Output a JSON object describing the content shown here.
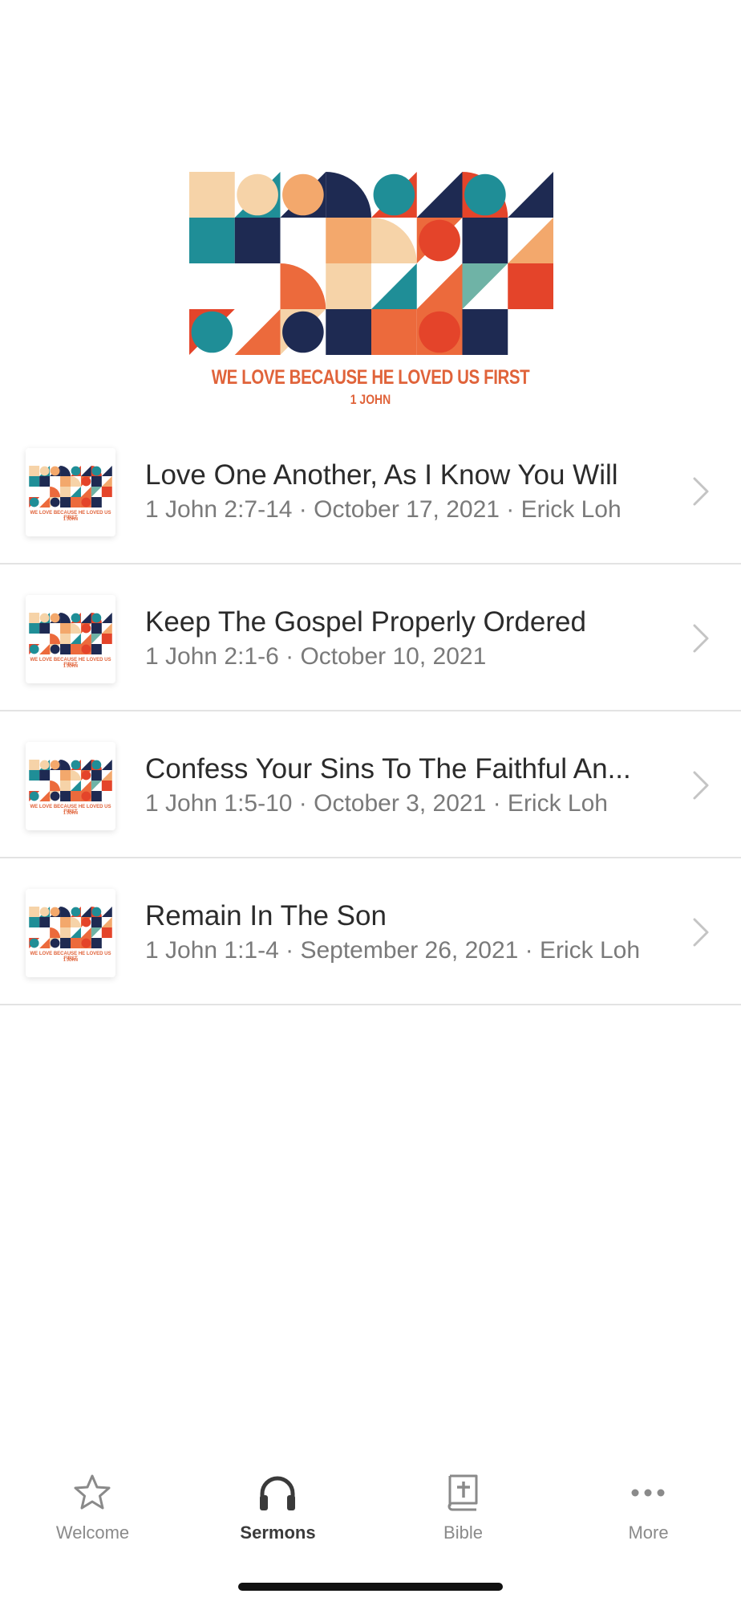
{
  "series": {
    "caption": "WE LOVE BECAUSE HE LOVED US FIRST",
    "subcaption": "1 JOHN",
    "thumb_caption": "WE LOVE BECAUSE HE LOVED US FIRST",
    "thumb_subcaption": "1 JOHN"
  },
  "sermons": [
    {
      "title": "Love One Another, As I Know You Will",
      "subtitle": "1 John 2:7-14 · October 17, 2021 · Erick Loh"
    },
    {
      "title": "Keep The Gospel Properly Ordered",
      "subtitle": "1 John 2:1-6 · October 10, 2021"
    },
    {
      "title": "Confess Your Sins To The Faithful An...",
      "subtitle": "1 John 1:5-10 · October 3, 2021 · Erick Loh"
    },
    {
      "title": "Remain In The Son",
      "subtitle": "1 John 1:1-4 · September 26, 2021 · Erick Loh"
    }
  ],
  "tabs": [
    {
      "label": "Welcome",
      "icon": "star-icon",
      "active": false
    },
    {
      "label": "Sermons",
      "icon": "headphones-icon",
      "active": true
    },
    {
      "label": "Bible",
      "icon": "bible-icon",
      "active": false
    },
    {
      "label": "More",
      "icon": "more-icon",
      "active": false
    }
  ],
  "colors": {
    "navy": "#1e2a52",
    "teal": "#1f8e97",
    "orange": "#ec6a3c",
    "peach": "#f3a86c",
    "cream": "#f6d3a8",
    "red": "#e4442a",
    "sage": "#6fb3a6",
    "caption": "#e0633a"
  }
}
